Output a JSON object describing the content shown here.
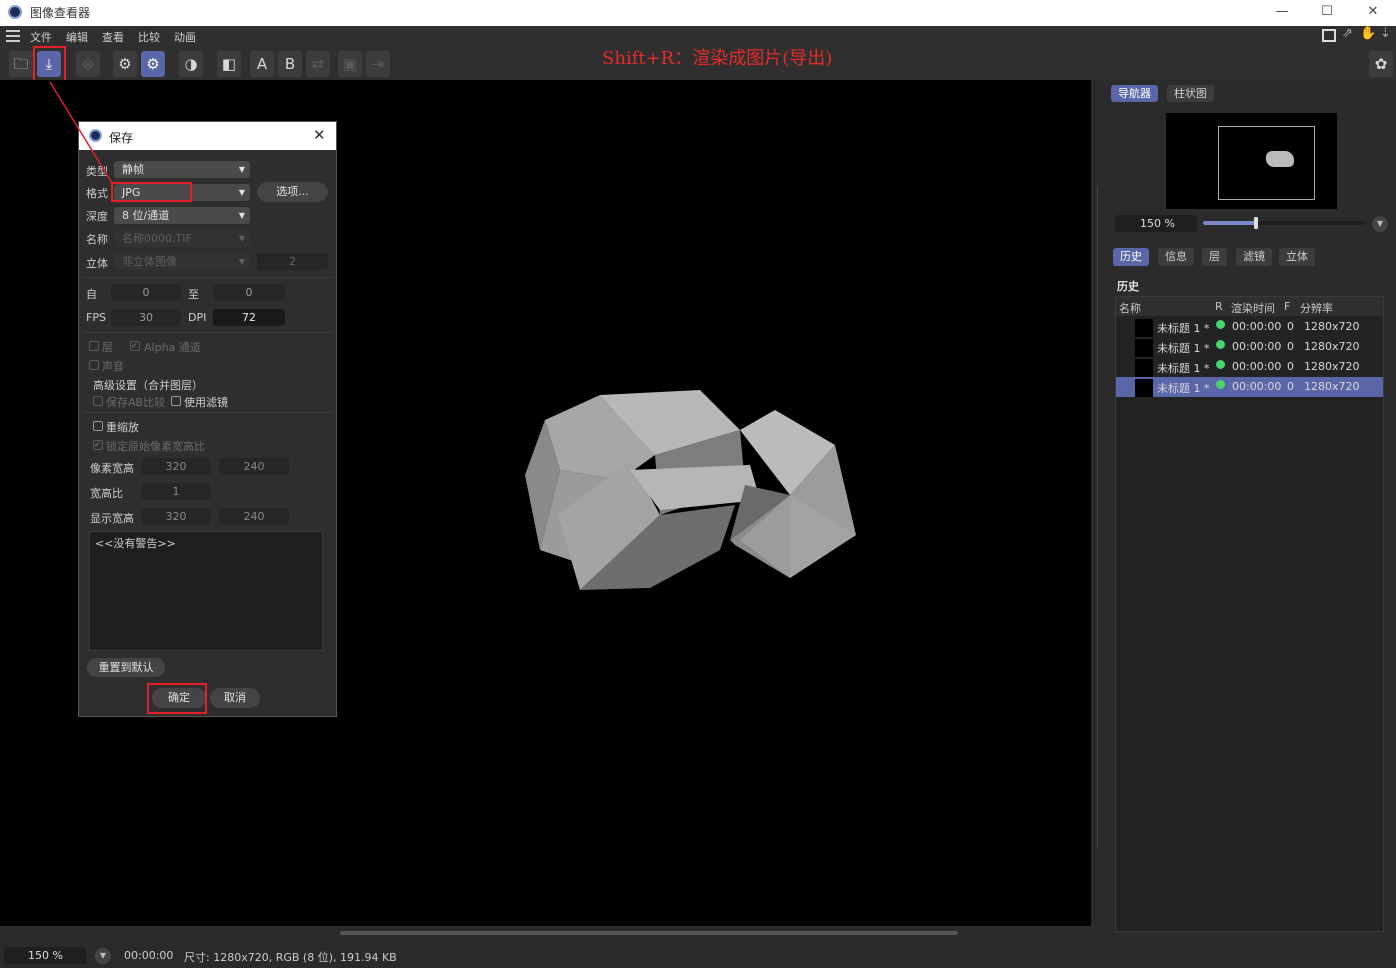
{
  "window": {
    "title": "图像查看器",
    "minimize": "—",
    "maximize": "☐",
    "close": "✕"
  },
  "menu": [
    "文件",
    "编辑",
    "查看",
    "比较",
    "动画"
  ],
  "toolbar": {
    "a": "A",
    "b": "B"
  },
  "annotation": "Shift+R：渲染成图片(导出)",
  "statusbar": {
    "zoom": "150 %",
    "time": "00:00:00",
    "info": "尺寸: 1280x720, RGB (8 位), 191.94 KB"
  },
  "navigator": {
    "tabs": [
      "导航器",
      "柱状图"
    ],
    "zoom": "150 %",
    "zoom_fraction": 0.33
  },
  "info_tabs": [
    "历史",
    "信息",
    "层",
    "滤镜",
    "立体"
  ],
  "history": {
    "heading": "历史",
    "columns": [
      "名称",
      "R",
      "渲染时间",
      "F",
      "分辨率"
    ],
    "rows": [
      {
        "name": "未标题 1 *",
        "time": "00:00:00",
        "f": "0",
        "res": "1280x720"
      },
      {
        "name": "未标题 1 *",
        "time": "00:00:00",
        "f": "0",
        "res": "1280x720"
      },
      {
        "name": "未标题 1 *",
        "time": "00:00:00",
        "f": "0",
        "res": "1280x720"
      },
      {
        "name": "未标题 1 *",
        "time": "00:00:00",
        "f": "0",
        "res": "1280x720"
      }
    ],
    "status_color": "#49d36b"
  },
  "dialog": {
    "title": "保存",
    "type_label": "类型",
    "type_value": "静帧",
    "format_label": "格式",
    "format_value": "JPG",
    "options_btn": "选项...",
    "depth_label": "深度",
    "depth_value": "8 位/通道",
    "name_label": "名称",
    "name_placeholder": "名称0000.TIF",
    "stereo_label": "立体",
    "stereo_value": "非立体图像",
    "stereo_num": "2",
    "from_label": "自",
    "from_value": "0",
    "to_label": "至",
    "to_value": "0",
    "fps_label": "FPS",
    "fps_value": "30",
    "dpi_label": "DPI",
    "dpi_value": "72",
    "layer_label": "层",
    "alpha_label": "Alpha 通道",
    "sound_label": "声音",
    "advanced_label": "高级设置（合并图层）",
    "save_ab_label": "保存AB比较",
    "use_filter_label": "使用滤镜",
    "rescale_label": "重缩放",
    "lock_ratio_label": "锁定原始像素宽高比",
    "pixel_label": "像素宽高",
    "pixel_w": "320",
    "pixel_h": "240",
    "ratio_label": "宽高比",
    "ratio_value": "1",
    "display_label": "显示宽高",
    "display_w": "320",
    "display_h": "240",
    "warning_text": "<<没有警告>>",
    "reset_btn": "重置到默认",
    "ok_btn": "确定",
    "cancel_btn": "取消"
  },
  "colors": {
    "accent": "#5b66a8",
    "annotation_red": "#e62a2a"
  }
}
